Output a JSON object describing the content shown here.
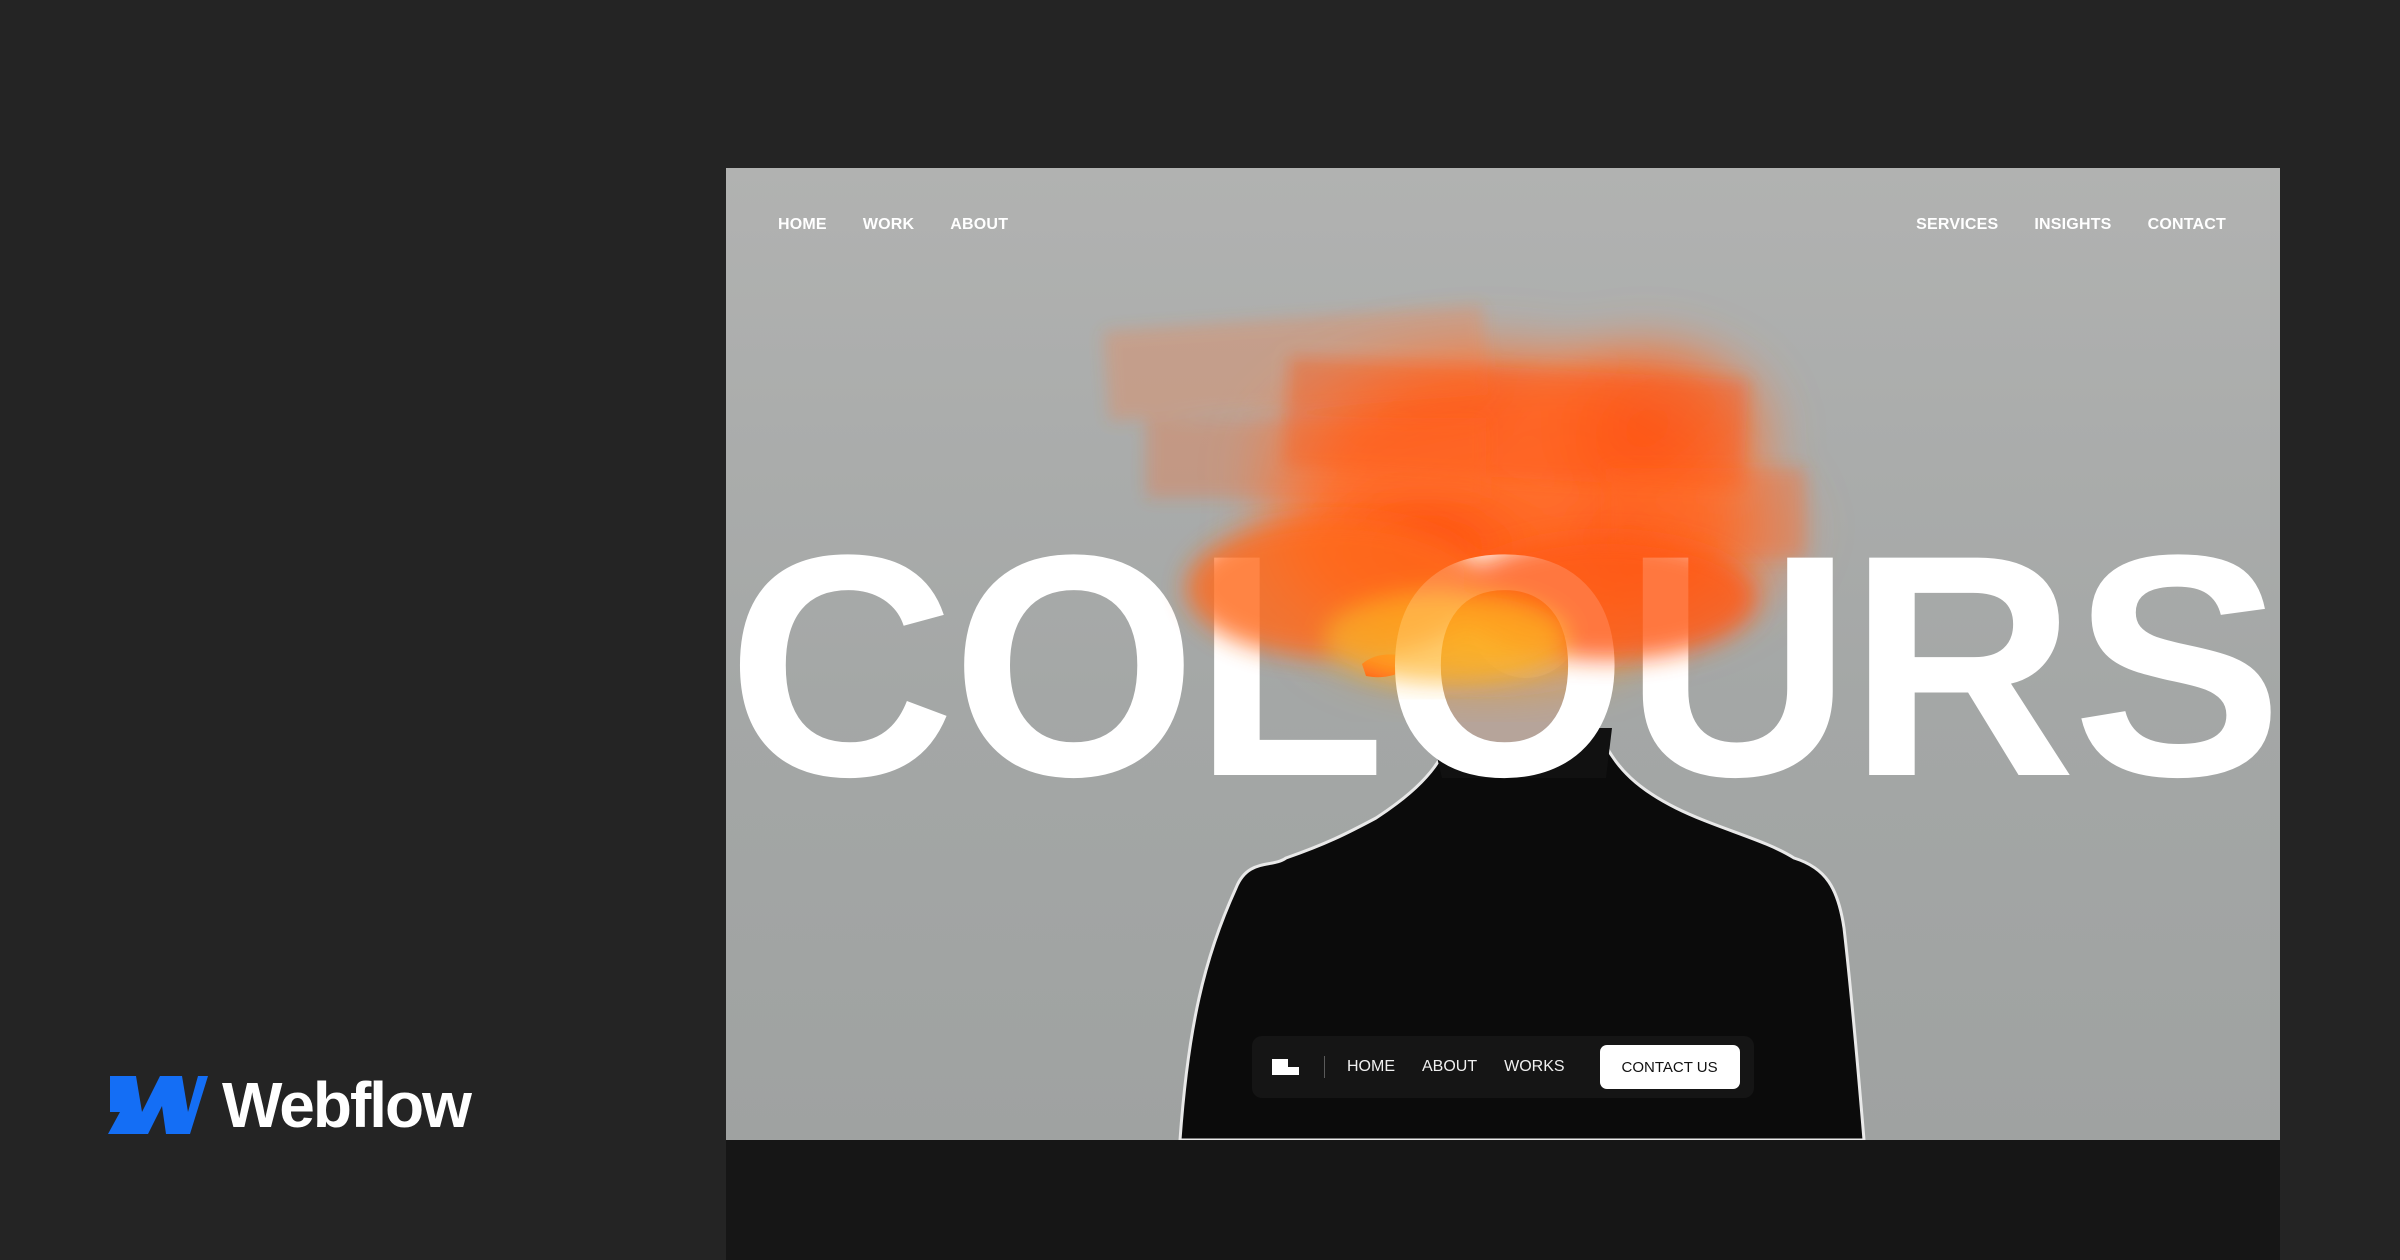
{
  "brand": {
    "name": "Webflow",
    "logo_icon": "webflow-logo-icon",
    "accent": "#146ef5"
  },
  "site": {
    "topnav_left": [
      {
        "label": "HOME"
      },
      {
        "label": "WORK"
      },
      {
        "label": "ABOUT"
      }
    ],
    "topnav_right": [
      {
        "label": "SERVICES"
      },
      {
        "label": "INSIGHTS"
      },
      {
        "label": "CONTACT"
      }
    ],
    "hero": {
      "title": "COLOURS",
      "accent": "#ff5a1a"
    },
    "pillnav": {
      "logo_icon": "site-logo-icon",
      "links": [
        {
          "label": "HOME"
        },
        {
          "label": "ABOUT"
        },
        {
          "label": "WORKS"
        }
      ],
      "cta_label": "CONTACT US"
    }
  }
}
